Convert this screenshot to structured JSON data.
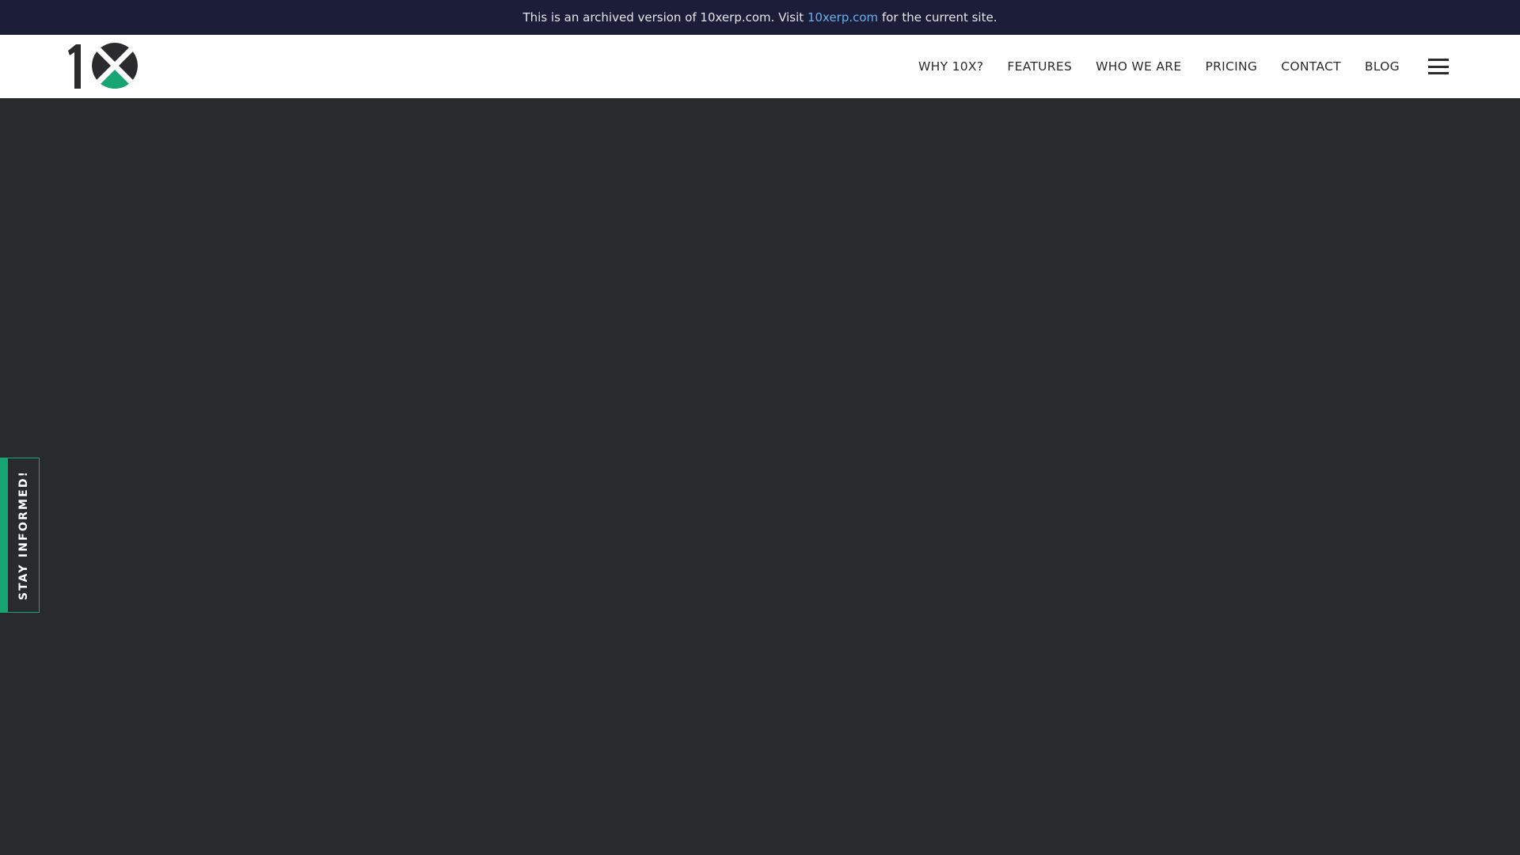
{
  "archive_banner": {
    "text_before": "This is an archived version of 10xerp.com. Visit ",
    "link_text": "10xerp.com",
    "text_after": " for the current site.",
    "link_color": "#6ab0ec",
    "background": "#1c1d38"
  },
  "header": {
    "logo": {
      "text": "1X",
      "icon": "10x-logo-icon",
      "accent_color": "#16a573",
      "dark_color": "#2b2b2e"
    },
    "nav": [
      {
        "label": "WHY 10X?"
      },
      {
        "label": "FEATURES"
      },
      {
        "label": "WHO WE ARE"
      },
      {
        "label": "PRICING"
      },
      {
        "label": "CONTACT"
      },
      {
        "label": "BLOG"
      }
    ],
    "menu_icon": "hamburger-menu-icon"
  },
  "hero": {
    "background": "#292a2e"
  },
  "stay_informed": {
    "label": "STAY INFORMED!",
    "accent_color": "#16a573"
  }
}
